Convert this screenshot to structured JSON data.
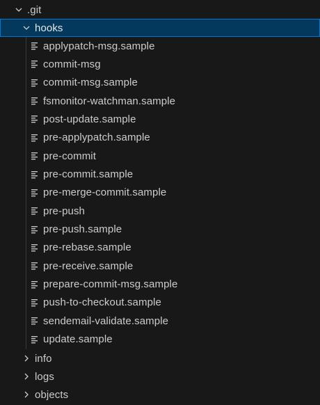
{
  "explorer": {
    "root_folder": {
      "label": ".git",
      "icon": "chevron-down-icon"
    },
    "hooks_folder": {
      "label": "hooks",
      "icon": "chevron-down-icon"
    },
    "hook_files": [
      {
        "label": "applypatch-msg.sample",
        "icon": "file-lines-icon"
      },
      {
        "label": "commit-msg",
        "icon": "file-lines-icon"
      },
      {
        "label": "commit-msg.sample",
        "icon": "file-lines-icon"
      },
      {
        "label": "fsmonitor-watchman.sample",
        "icon": "file-lines-icon"
      },
      {
        "label": "post-update.sample",
        "icon": "file-lines-icon"
      },
      {
        "label": "pre-applypatch.sample",
        "icon": "file-lines-icon"
      },
      {
        "label": "pre-commit",
        "icon": "file-lines-icon"
      },
      {
        "label": "pre-commit.sample",
        "icon": "file-lines-icon"
      },
      {
        "label": "pre-merge-commit.sample",
        "icon": "file-lines-icon"
      },
      {
        "label": "pre-push",
        "icon": "file-lines-icon"
      },
      {
        "label": "pre-push.sample",
        "icon": "file-lines-icon"
      },
      {
        "label": "pre-rebase.sample",
        "icon": "file-lines-icon"
      },
      {
        "label": "pre-receive.sample",
        "icon": "file-lines-icon"
      },
      {
        "label": "prepare-commit-msg.sample",
        "icon": "file-lines-icon"
      },
      {
        "label": "push-to-checkout.sample",
        "icon": "file-lines-icon"
      },
      {
        "label": "sendemail-validate.sample",
        "icon": "file-lines-icon"
      },
      {
        "label": "update.sample",
        "icon": "file-lines-icon"
      }
    ],
    "sibling_folders": [
      {
        "label": "info",
        "icon": "chevron-right-icon"
      },
      {
        "label": "logs",
        "icon": "chevron-right-icon"
      },
      {
        "label": "objects",
        "icon": "chevron-right-icon"
      }
    ]
  },
  "colors": {
    "background": "#181818",
    "selected_background": "#04395e",
    "selected_border": "#0078d4",
    "text": "#cccccc",
    "indent_guide": "#3a3a3a"
  }
}
